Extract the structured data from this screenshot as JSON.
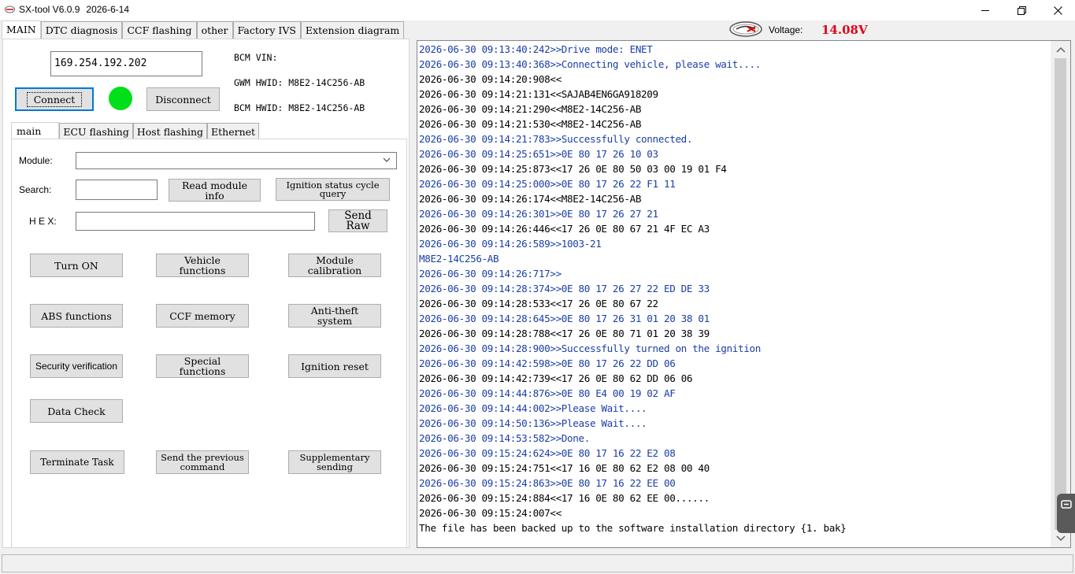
{
  "window": {
    "title": "SX-tool V6.0.9",
    "date": "2026-6-14"
  },
  "main_tabs": [
    {
      "label": "MAIN",
      "active": true
    },
    {
      "label": "DTC diagnosis"
    },
    {
      "label": "CCF flashing"
    },
    {
      "label": "other"
    },
    {
      "label": "Factory IVS"
    },
    {
      "label": "Extension diagram"
    }
  ],
  "voltage": {
    "label": "Voltage:",
    "value": "14.08V",
    "color": "#e0001a"
  },
  "connection": {
    "ip": "169.254.192.202",
    "connect_label": "Connect",
    "disconnect_label": "Disconnect",
    "status_color": "#00e01a",
    "bcm_vin": "BCM VIN:",
    "gwm_hwid": "GWM HWID: M8E2-14C256-AB",
    "bcm_hwid": "BCM HWID: M8E2-14C256-AB"
  },
  "sub_tabs": [
    {
      "label": "main",
      "active": true
    },
    {
      "label": "ECU flashing"
    },
    {
      "label": "Host flashing"
    },
    {
      "label": "Ethernet"
    }
  ],
  "form": {
    "module_label": "Module:",
    "module_value": "",
    "search_label": "Search:",
    "search_value": "",
    "read_module_info": "Read module info",
    "ignition_status": "Ignition status cycle query",
    "hex_label": "H E X:",
    "hex_value": "",
    "send_raw": "Send Raw"
  },
  "functions": {
    "turn_on": "Turn ON",
    "vehicle_functions": "Vehicle functions",
    "module_calibration": "Module calibration",
    "abs_functions": "ABS functions",
    "ccf_memory": "CCF memory",
    "anti_theft": "Anti-theft system",
    "security_verification": "Security verification",
    "special_functions": "Special functions",
    "ignition_reset": "Ignition reset",
    "data_check": "Data Check",
    "terminate_task": "Terminate Task",
    "send_previous": "Send the previous command",
    "supplementary": "Supplementary sending"
  },
  "log": [
    {
      "dir": "out",
      "text": "2026-06-30 09:13:40:242>>Drive mode: ENET"
    },
    {
      "dir": "out",
      "text": "2026-06-30 09:13:40:368>>Connecting vehicle, please wait...."
    },
    {
      "dir": "in",
      "text": "2026-06-30 09:14:20:908<<"
    },
    {
      "dir": "in",
      "text": "2026-06-30 09:14:21:131<<SAJAB4EN6GA918209"
    },
    {
      "dir": "in",
      "text": "2026-06-30 09:14:21:290<<M8E2-14C256-AB"
    },
    {
      "dir": "in",
      "text": "2026-06-30 09:14:21:530<<M8E2-14C256-AB"
    },
    {
      "dir": "out",
      "text": "2026-06-30 09:14:21:783>>Successfully connected."
    },
    {
      "dir": "out",
      "text": "2026-06-30 09:14:25:651>>0E 80 17 26 10 03"
    },
    {
      "dir": "in",
      "text": "2026-06-30 09:14:25:873<<17 26 0E 80 50 03 00 19 01 F4"
    },
    {
      "dir": "out",
      "text": "2026-06-30 09:14:25:000>>0E 80 17 26 22 F1 11"
    },
    {
      "dir": "in",
      "text": "2026-06-30 09:14:26:174<<M8E2-14C256-AB"
    },
    {
      "dir": "out",
      "text": "2026-06-30 09:14:26:301>>0E 80 17 26 27 21"
    },
    {
      "dir": "in",
      "text": "2026-06-30 09:14:26:446<<17 26 0E 80 67 21 4F EC A3"
    },
    {
      "dir": "out",
      "text": "2026-06-30 09:14:26:589>>1003-21"
    },
    {
      "dir": "out",
      "text": "M8E2-14C256-AB"
    },
    {
      "dir": "out",
      "text": "2026-06-30 09:14:26:717>>"
    },
    {
      "dir": "out",
      "text": "2026-06-30 09:14:28:374>>0E 80 17 26 27 22 ED DE 33"
    },
    {
      "dir": "in",
      "text": "2026-06-30 09:14:28:533<<17 26 0E 80 67 22"
    },
    {
      "dir": "out",
      "text": "2026-06-30 09:14:28:645>>0E 80 17 26 31 01 20 38 01"
    },
    {
      "dir": "in",
      "text": "2026-06-30 09:14:28:788<<17 26 0E 80 71 01 20 38 39"
    },
    {
      "dir": "out",
      "text": "2026-06-30 09:14:28:900>>Successfully turned on the ignition"
    },
    {
      "dir": "out",
      "text": "2026-06-30 09:14:42:598>>0E 80 17 26 22 DD 06"
    },
    {
      "dir": "in",
      "text": "2026-06-30 09:14:42:739<<17 26 0E 80 62 DD 06 06"
    },
    {
      "dir": "out",
      "text": "2026-06-30 09:14:44:876>>0E 80 E4 00 19 02 AF"
    },
    {
      "dir": "out",
      "text": "2026-06-30 09:14:44:002>>Please Wait...."
    },
    {
      "dir": "out",
      "text": "2026-06-30 09:14:50:136>>Please Wait...."
    },
    {
      "dir": "out",
      "text": "2026-06-30 09:14:53:582>>Done."
    },
    {
      "dir": "out",
      "text": "2026-06-30 09:15:24:624>>0E 80 17 16 22 E2 08"
    },
    {
      "dir": "in",
      "text": "2026-06-30 09:15:24:751<<17 16 0E 80 62 E2 08 00 40"
    },
    {
      "dir": "out",
      "text": "2026-06-30 09:15:24:863>>0E 80 17 16 22 EE 00"
    },
    {
      "dir": "in",
      "text": "2026-06-30 09:15:24:884<<17 16 0E 80 62 EE 00......"
    },
    {
      "dir": "in",
      "text": "2026-06-30 09:15:24:007<<"
    },
    {
      "dir": "in",
      "text": "The file has been backed up to the software installation directory {1. bak}"
    }
  ]
}
